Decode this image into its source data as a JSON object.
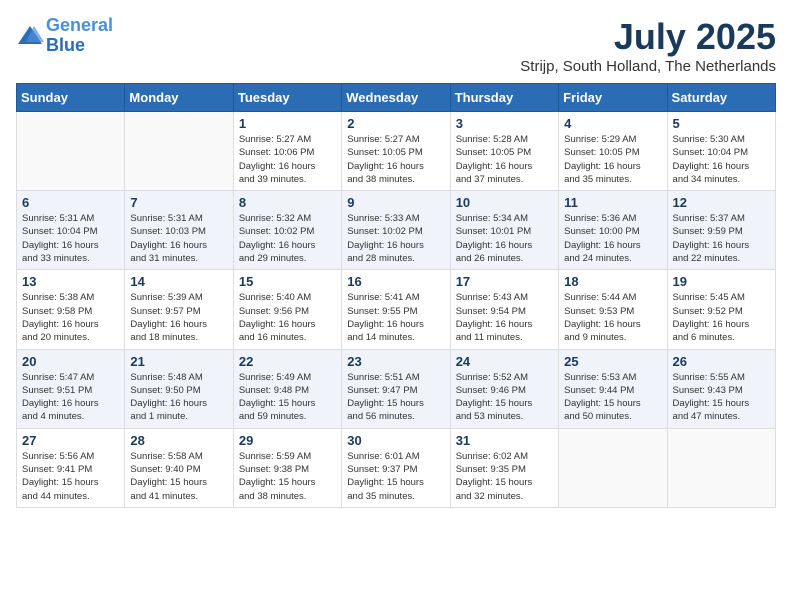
{
  "logo": {
    "line1": "General",
    "line2": "Blue"
  },
  "title": "July 2025",
  "subtitle": "Strijp, South Holland, The Netherlands",
  "weekdays": [
    "Sunday",
    "Monday",
    "Tuesday",
    "Wednesday",
    "Thursday",
    "Friday",
    "Saturday"
  ],
  "weeks": [
    [
      {
        "day": "",
        "info": ""
      },
      {
        "day": "",
        "info": ""
      },
      {
        "day": "1",
        "info": "Sunrise: 5:27 AM\nSunset: 10:06 PM\nDaylight: 16 hours\nand 39 minutes."
      },
      {
        "day": "2",
        "info": "Sunrise: 5:27 AM\nSunset: 10:05 PM\nDaylight: 16 hours\nand 38 minutes."
      },
      {
        "day": "3",
        "info": "Sunrise: 5:28 AM\nSunset: 10:05 PM\nDaylight: 16 hours\nand 37 minutes."
      },
      {
        "day": "4",
        "info": "Sunrise: 5:29 AM\nSunset: 10:05 PM\nDaylight: 16 hours\nand 35 minutes."
      },
      {
        "day": "5",
        "info": "Sunrise: 5:30 AM\nSunset: 10:04 PM\nDaylight: 16 hours\nand 34 minutes."
      }
    ],
    [
      {
        "day": "6",
        "info": "Sunrise: 5:31 AM\nSunset: 10:04 PM\nDaylight: 16 hours\nand 33 minutes."
      },
      {
        "day": "7",
        "info": "Sunrise: 5:31 AM\nSunset: 10:03 PM\nDaylight: 16 hours\nand 31 minutes."
      },
      {
        "day": "8",
        "info": "Sunrise: 5:32 AM\nSunset: 10:02 PM\nDaylight: 16 hours\nand 29 minutes."
      },
      {
        "day": "9",
        "info": "Sunrise: 5:33 AM\nSunset: 10:02 PM\nDaylight: 16 hours\nand 28 minutes."
      },
      {
        "day": "10",
        "info": "Sunrise: 5:34 AM\nSunset: 10:01 PM\nDaylight: 16 hours\nand 26 minutes."
      },
      {
        "day": "11",
        "info": "Sunrise: 5:36 AM\nSunset: 10:00 PM\nDaylight: 16 hours\nand 24 minutes."
      },
      {
        "day": "12",
        "info": "Sunrise: 5:37 AM\nSunset: 9:59 PM\nDaylight: 16 hours\nand 22 minutes."
      }
    ],
    [
      {
        "day": "13",
        "info": "Sunrise: 5:38 AM\nSunset: 9:58 PM\nDaylight: 16 hours\nand 20 minutes."
      },
      {
        "day": "14",
        "info": "Sunrise: 5:39 AM\nSunset: 9:57 PM\nDaylight: 16 hours\nand 18 minutes."
      },
      {
        "day": "15",
        "info": "Sunrise: 5:40 AM\nSunset: 9:56 PM\nDaylight: 16 hours\nand 16 minutes."
      },
      {
        "day": "16",
        "info": "Sunrise: 5:41 AM\nSunset: 9:55 PM\nDaylight: 16 hours\nand 14 minutes."
      },
      {
        "day": "17",
        "info": "Sunrise: 5:43 AM\nSunset: 9:54 PM\nDaylight: 16 hours\nand 11 minutes."
      },
      {
        "day": "18",
        "info": "Sunrise: 5:44 AM\nSunset: 9:53 PM\nDaylight: 16 hours\nand 9 minutes."
      },
      {
        "day": "19",
        "info": "Sunrise: 5:45 AM\nSunset: 9:52 PM\nDaylight: 16 hours\nand 6 minutes."
      }
    ],
    [
      {
        "day": "20",
        "info": "Sunrise: 5:47 AM\nSunset: 9:51 PM\nDaylight: 16 hours\nand 4 minutes."
      },
      {
        "day": "21",
        "info": "Sunrise: 5:48 AM\nSunset: 9:50 PM\nDaylight: 16 hours\nand 1 minute."
      },
      {
        "day": "22",
        "info": "Sunrise: 5:49 AM\nSunset: 9:48 PM\nDaylight: 15 hours\nand 59 minutes."
      },
      {
        "day": "23",
        "info": "Sunrise: 5:51 AM\nSunset: 9:47 PM\nDaylight: 15 hours\nand 56 minutes."
      },
      {
        "day": "24",
        "info": "Sunrise: 5:52 AM\nSunset: 9:46 PM\nDaylight: 15 hours\nand 53 minutes."
      },
      {
        "day": "25",
        "info": "Sunrise: 5:53 AM\nSunset: 9:44 PM\nDaylight: 15 hours\nand 50 minutes."
      },
      {
        "day": "26",
        "info": "Sunrise: 5:55 AM\nSunset: 9:43 PM\nDaylight: 15 hours\nand 47 minutes."
      }
    ],
    [
      {
        "day": "27",
        "info": "Sunrise: 5:56 AM\nSunset: 9:41 PM\nDaylight: 15 hours\nand 44 minutes."
      },
      {
        "day": "28",
        "info": "Sunrise: 5:58 AM\nSunset: 9:40 PM\nDaylight: 15 hours\nand 41 minutes."
      },
      {
        "day": "29",
        "info": "Sunrise: 5:59 AM\nSunset: 9:38 PM\nDaylight: 15 hours\nand 38 minutes."
      },
      {
        "day": "30",
        "info": "Sunrise: 6:01 AM\nSunset: 9:37 PM\nDaylight: 15 hours\nand 35 minutes."
      },
      {
        "day": "31",
        "info": "Sunrise: 6:02 AM\nSunset: 9:35 PM\nDaylight: 15 hours\nand 32 minutes."
      },
      {
        "day": "",
        "info": ""
      },
      {
        "day": "",
        "info": ""
      }
    ]
  ]
}
